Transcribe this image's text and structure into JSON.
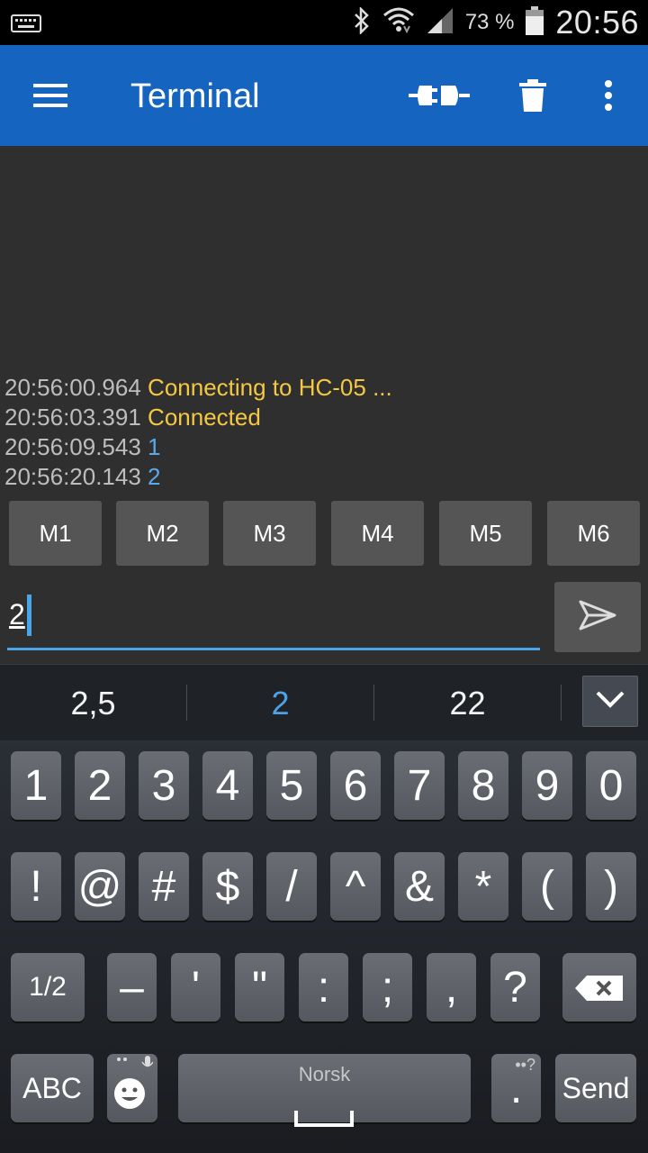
{
  "status_bar": {
    "keyboard_icon": "keyboard-icon",
    "bluetooth_icon": "bluetooth-icon",
    "wifi_icon": "wifi-icon",
    "signal_icon": "signal-icon",
    "battery_percent": "73 %",
    "battery_icon": "battery-icon",
    "time": "20:56"
  },
  "app_bar": {
    "title": "Terminal",
    "menu_icon": "hamburger-menu-icon",
    "connect_icon": "plug-connect-icon",
    "delete_icon": "trash-icon",
    "overflow_icon": "more-vert-icon",
    "color": "#1565c0"
  },
  "terminal": {
    "log": [
      {
        "time": "20:56:00.964",
        "text": "Connecting to HC-05 ...",
        "kind": "status"
      },
      {
        "time": "20:56:03.391",
        "text": "Connected",
        "kind": "status"
      },
      {
        "time": "20:56:09.543",
        "text": "1",
        "kind": "data"
      },
      {
        "time": "20:56:20.143",
        "text": "2",
        "kind": "data"
      }
    ],
    "macros": [
      "M1",
      "M2",
      "M3",
      "M4",
      "M5",
      "M6"
    ],
    "input_value": "2",
    "send_icon": "send-arrow-icon"
  },
  "suggestions": {
    "items": [
      "2,5",
      "2",
      "22"
    ],
    "active_index": 1,
    "collapse_icon": "chevron-down-icon"
  },
  "keyboard": {
    "row1": [
      "1",
      "2",
      "3",
      "4",
      "5",
      "6",
      "7",
      "8",
      "9",
      "0"
    ],
    "row2": [
      "!",
      "@",
      "#",
      "$",
      "/",
      "^",
      "&",
      "*",
      "(",
      ")"
    ],
    "row3": [
      "1/2",
      "–",
      "'",
      "\"",
      ":",
      ";",
      ",",
      "?"
    ],
    "backspace_icon": "backspace-icon",
    "abc_label": "ABC",
    "emoji_icon": "emoji-mic-icon",
    "space_label": "Norsk",
    "period": ".",
    "send_label": "Send"
  }
}
